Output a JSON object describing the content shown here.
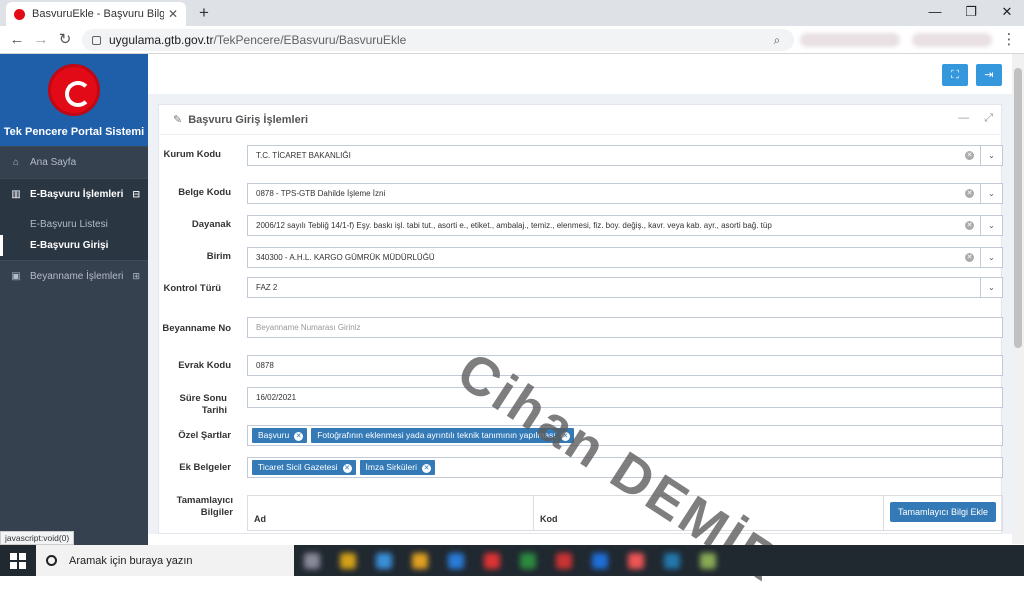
{
  "browser": {
    "tab_title": "BasvuruEkle - Başvuru Bilgi Sisten",
    "tab_close": "✕",
    "new_tab": "+",
    "url_host": "uygulama.gtb.gov.tr",
    "url_path": "/TekPencere/EBasvuru/BasvuruEkle",
    "minimize": "—",
    "restore": "❐",
    "close": "✕"
  },
  "sidebar": {
    "brand": "Tek Pencere Portal Sistemi",
    "items": [
      {
        "label": "Ana Sayfa",
        "icon": "home-icon",
        "glyph": "⌂"
      },
      {
        "label": "E-Başvuru İşlemleri",
        "icon": "bar-chart-icon",
        "glyph": "▥",
        "toggle": "⊟"
      },
      {
        "label": "Beyanname İşlemleri",
        "icon": "image-icon",
        "glyph": "▣",
        "toggle": "⊞"
      }
    ],
    "submenu": [
      "E-Başvuru Listesi",
      "E-Başvuru Girişi"
    ]
  },
  "portlet": {
    "title": "Başvuru Giriş İşlemleri",
    "edit_icon": "✎",
    "minimize": "—",
    "expand": "⤢"
  },
  "form": {
    "kurum": {
      "label": "Kurum Kodu",
      "value": "T.C. TİCARET BAKANLIĞI"
    },
    "belge": {
      "label": "Belge Kodu",
      "value": "0878 - TPS-GTB Dahilde İşleme İzni"
    },
    "dayanak": {
      "label": "Dayanak",
      "value": "2006/12 sayılı Tebliğ 14/1-f) Eşy. baskı işl. tabi tut., asorti e., etiket., ambalaj., temiz., elenmesi, fiz. boy. değiş., kavr. veya kab. ayr., asorti bağ. tüp"
    },
    "birim": {
      "label": "Birim",
      "value": "340300 - A.H.L. KARGO GÜMRÜK MÜDÜRLÜĞÜ"
    },
    "kontrol": {
      "label": "Kontrol Türü",
      "value": "FAZ 2"
    },
    "beyanname": {
      "label": "Beyanname No",
      "placeholder": "Beyanname Numarası Giriniz"
    },
    "evrak": {
      "label": "Evrak Kodu",
      "value": "0878"
    },
    "sure": {
      "label": "Süre Sonu Tarihi",
      "value": "16/02/2021"
    },
    "ozel": {
      "label": "Özel Şartlar",
      "tags": [
        "Başvuru",
        "Fotoğrafının eklenmesi yada ayrıntılı teknik tanımının yapılması"
      ]
    },
    "ek": {
      "label": "Ek Belgeler",
      "tags": [
        "Ticaret Sicil Gazetesi",
        "İmza Sirküleri"
      ]
    },
    "tamamlayici": {
      "label": "Tamamlayıcı Bilgiler",
      "col_ad": "Ad",
      "col_kod": "Kod",
      "add_button": "Tamamlayıcı Bilgi Ekle"
    }
  },
  "watermark": "Cihan DEMİR",
  "status_text": "javascript:void(0)",
  "taskbar": {
    "search_placeholder": "Aramak için buraya yazın"
  }
}
